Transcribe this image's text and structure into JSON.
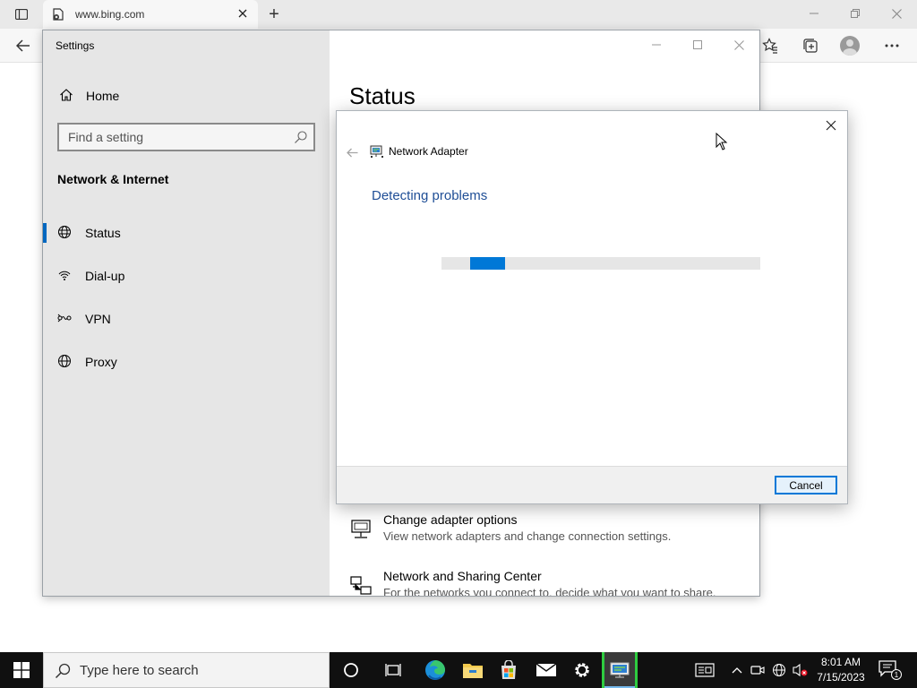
{
  "browser": {
    "tab_title": "www.bing.com",
    "new_tab_symbol": "+",
    "colors": {
      "tabstrip": "#e9e9e9",
      "toolbar": "#f7f7f7"
    }
  },
  "settings": {
    "window_title": "Settings",
    "home_label": "Home",
    "search_placeholder": "Find a setting",
    "section_title": "Network & Internet",
    "nav_items": [
      {
        "label": "Status",
        "icon": "globe-status-icon",
        "active": true
      },
      {
        "label": "Dial-up",
        "icon": "dialup-icon",
        "active": false
      },
      {
        "label": "VPN",
        "icon": "vpn-icon",
        "active": false
      },
      {
        "label": "Proxy",
        "icon": "globe-icon",
        "active": false
      }
    ],
    "page_title": "Status",
    "links": [
      {
        "title": "Change adapter options",
        "subtitle": "View network adapters and change connection settings.",
        "icon": "adapter-icon"
      },
      {
        "title": "Network and Sharing Center",
        "subtitle": "For the networks you connect to, decide what you want to share.",
        "icon": "sharing-center-icon"
      }
    ],
    "colors": {
      "sidebar": "#e6e6e6",
      "accent": "#0067c0"
    }
  },
  "dialog": {
    "app_title": "Network Adapter",
    "heading": "Detecting problems",
    "progress_fraction": 0.11,
    "cancel_label": "Cancel",
    "colors": {
      "heading": "#1f4e96",
      "progress": "#0078d7"
    }
  },
  "taskbar": {
    "search_placeholder": "Type here to search",
    "time": "8:01 AM",
    "date": "7/15/2023",
    "notification_count": "1",
    "apps": [
      "cortana-icon",
      "task-view-icon",
      "edge-icon",
      "file-explorer-icon",
      "store-icon",
      "mail-icon",
      "settings-icon",
      "troubleshooter-icon"
    ]
  }
}
